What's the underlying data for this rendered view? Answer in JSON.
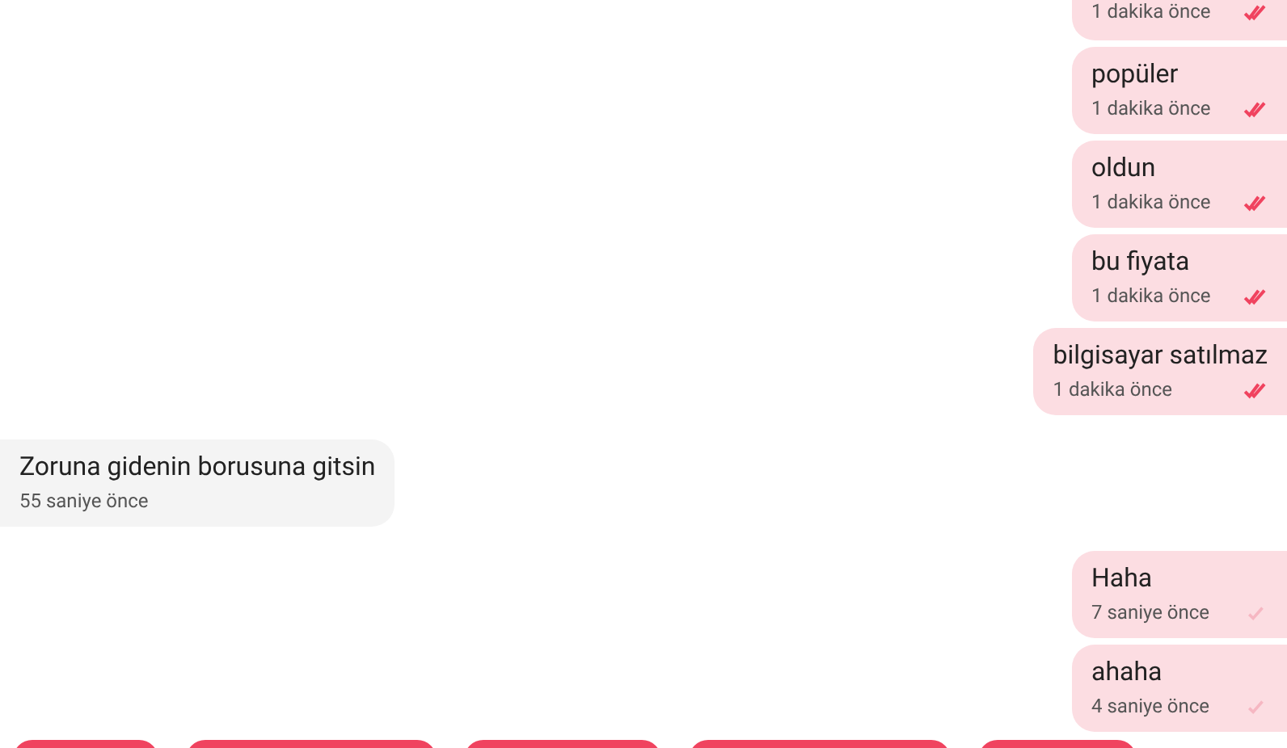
{
  "messages": [
    {
      "kind": "sent",
      "time": "1 dakika önce",
      "read": true
    },
    {
      "kind": "sent",
      "text": "popüler",
      "time": "1 dakika önce",
      "read": true
    },
    {
      "kind": "sent",
      "text": "oldun",
      "time": "1 dakika önce",
      "read": true
    },
    {
      "kind": "sent",
      "text": "bu fiyata",
      "time": "1 dakika önce",
      "read": true
    },
    {
      "kind": "sent",
      "text": "bilgisayar satılmaz",
      "time": "1 dakika önce",
      "read": true
    },
    {
      "kind": "received",
      "text": "Zoruna gidenin borusuna gitsin",
      "time": "55 saniye önce"
    },
    {
      "kind": "sent",
      "text": "Haha",
      "time": "7 saniye önce",
      "read": false
    },
    {
      "kind": "sent",
      "text": "ahaha",
      "time": "4 saniye önce",
      "read": false
    }
  ],
  "quick_replies": [
    {
      "kind": "chip"
    },
    {
      "kind": "chip"
    },
    {
      "kind": "chip"
    },
    {
      "kind": "chip"
    },
    {
      "kind": "chip"
    }
  ]
}
